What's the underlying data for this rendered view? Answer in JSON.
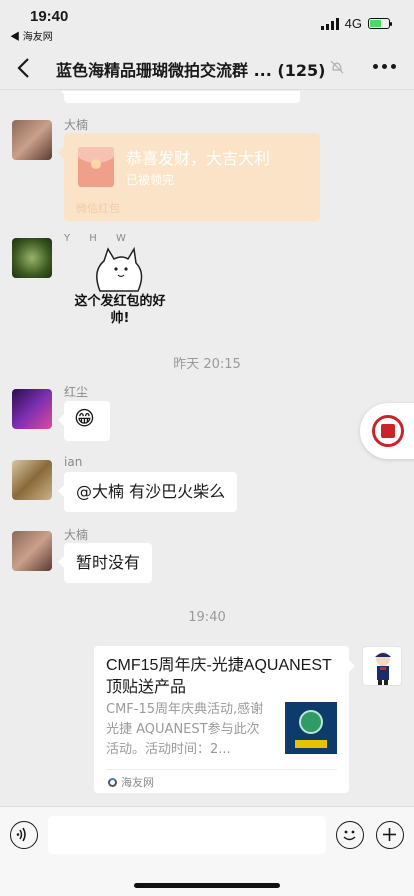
{
  "status_bar": {
    "time": "19:40",
    "back_app": "◀ 海友网",
    "network": "4G"
  },
  "nav": {
    "title": "蓝色海精品珊瑚微拍交流群 ... (125)"
  },
  "messages": {
    "red_packet": {
      "sender": "大楠",
      "title": "恭喜发财，大吉大利",
      "status": "已被领完",
      "footer": "微信红包"
    },
    "sticker": {
      "sender": "Y H W",
      "text": "这个发红包的好帅!"
    },
    "timestamp_1": "昨天 20:15",
    "emoji_msg": {
      "sender": "红尘",
      "emoji": "😁"
    },
    "ian_msg": {
      "sender": "ian",
      "text": "@大楠 有沙巴火柴么"
    },
    "reply_msg": {
      "sender": "大楠",
      "text": "暂时没有"
    },
    "timestamp_2": "19:40",
    "share": {
      "title": "CMF15周年庆-光捷AQUANEST顶贴送产品",
      "desc": "CMF-15周年庆典活动,感谢光捷 AQUANEST参与此次活动。活动时间：2...",
      "source": "海友网"
    }
  }
}
